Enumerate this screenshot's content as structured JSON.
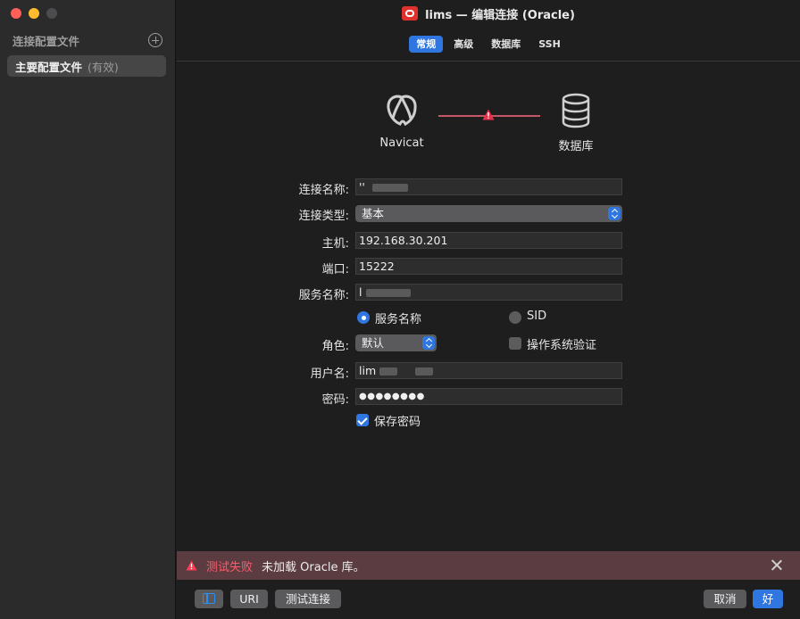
{
  "window": {
    "title": "lims — 编辑连接 (Oracle)",
    "tabs": [
      {
        "label": "常规",
        "active": true
      },
      {
        "label": "高级",
        "active": false
      },
      {
        "label": "数据库",
        "active": false
      },
      {
        "label": "SSH",
        "active": false
      }
    ]
  },
  "sidebar": {
    "header": "连接配置文件",
    "items": [
      {
        "name": "主要配置文件",
        "status": "(有效)"
      }
    ]
  },
  "diagram": {
    "client_label": "Navicat",
    "server_label": "数据库",
    "link_color": "#c45665",
    "status_icon": "warning-icon"
  },
  "form": {
    "connection_name": {
      "label": "连接名称:",
      "value": "''"
    },
    "connection_type": {
      "label": "连接类型:",
      "value": "基本"
    },
    "host": {
      "label": "主机:",
      "value": "192.168.30.201"
    },
    "port": {
      "label": "端口:",
      "value": "15222"
    },
    "service_name": {
      "label": "服务名称:",
      "value": "l"
    },
    "service_type_options": {
      "service_name": "服务名称",
      "sid": "SID",
      "selected": "服务名称"
    },
    "role": {
      "label": "角色:",
      "value": "默认"
    },
    "os_auth": {
      "label": "操作系统验证",
      "checked": false
    },
    "username": {
      "label": "用户名:",
      "value": "lim"
    },
    "password": {
      "label": "密码:",
      "value": "●●●●●●●●"
    },
    "save_password": {
      "label": "保存密码",
      "checked": true
    }
  },
  "error": {
    "title": "测试失败",
    "message": "未加载 Oracle 库。"
  },
  "buttons": {
    "uri": "URI",
    "test": "测试连接",
    "cancel": "取消",
    "ok": "好"
  },
  "colors": {
    "accent": "#2f76e0",
    "error": "#ff5a6e",
    "error_bar": "#5b3c40"
  }
}
